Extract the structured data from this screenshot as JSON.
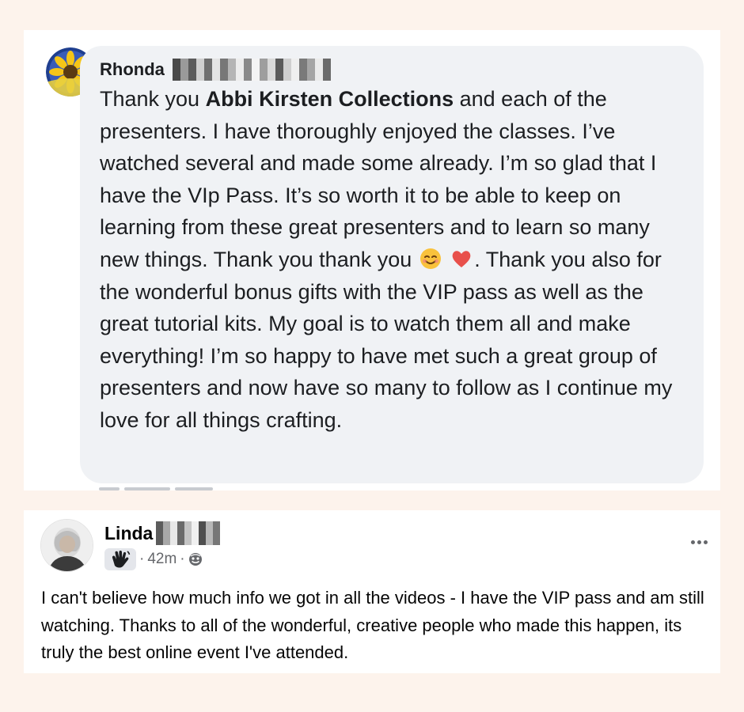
{
  "comment": {
    "author": "Rhonda",
    "text_before_bold": "Thank you ",
    "bold_mention": "Abbi Kirsten Collections",
    "text_after_bold": " and each of the presenters. I have thoroughly enjoyed the classes. I’ve watched several and made some already. I’m so glad that I have the VIp Pass. It’s so worth it to be able to keep on learning from these great presenters and to learn so many new things. Thank you thank you ",
    "text_after_emoji": ". Thank you also for the wonderful bonus gifts with the VIP pass as well as the great tutorial kits. My goal is to watch them all and make everything! I’m so happy to have met such a great group of presenters and now have so many to follow as I continue my love for all things crafting.",
    "emojis": [
      "smiling-face-emoji",
      "red-heart-emoji"
    ],
    "avatar_icon": "sunflower-avatar"
  },
  "post": {
    "author": "Linda",
    "time": "42m",
    "separator": "·",
    "badge_icon": "waving-hand-icon",
    "audience_icon": "public-globe-icon",
    "more_icon": "more-options-icon",
    "text": "I can't believe how much info we got in all the videos - I have the VIP pass and am still watching. Thanks to all of the wonderful, creative people who made this happen, its truly the best online event I've attended."
  }
}
